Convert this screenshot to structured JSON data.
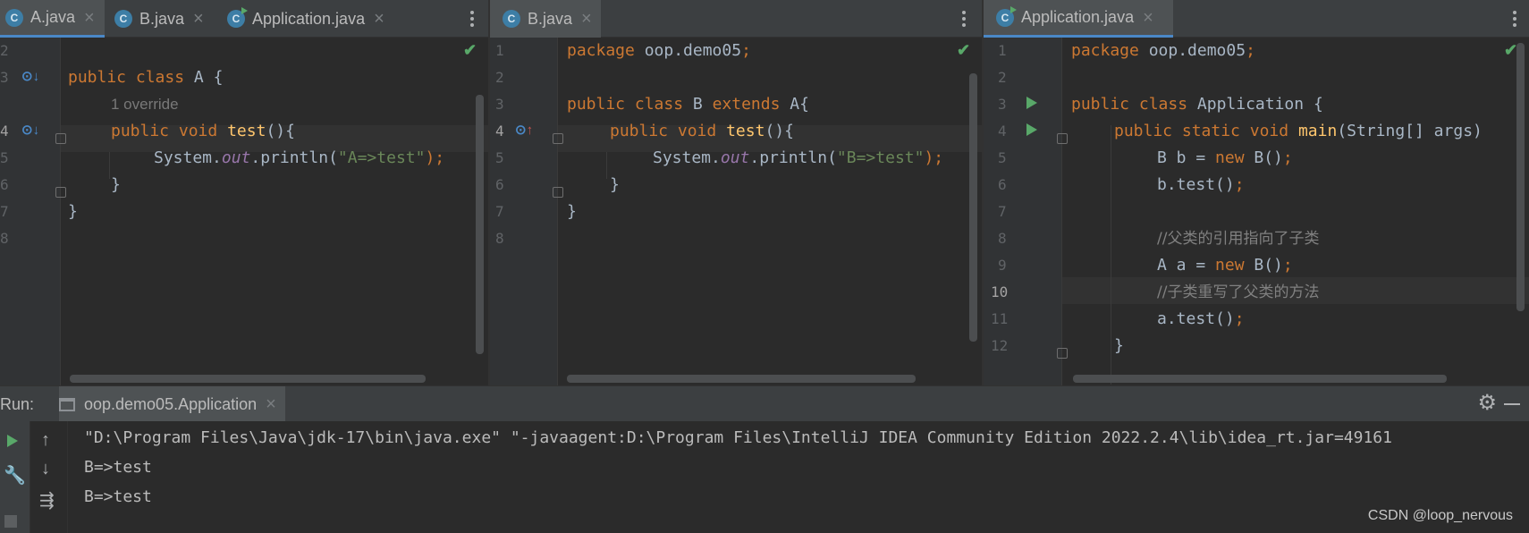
{
  "panes": [
    {
      "tabs": [
        {
          "label": "A.java",
          "icon": "class-icon",
          "active": true
        },
        {
          "label": "B.java",
          "icon": "class-icon"
        },
        {
          "label": "Application.java",
          "icon": "runnable-class-icon"
        }
      ],
      "line_numbers": [
        "2",
        "3",
        "4",
        "5",
        "6",
        "7",
        "8"
      ],
      "hint": "1 override",
      "code": {
        "l3": {
          "kw1": "public",
          "kw2": "class",
          "rest": " A {"
        },
        "l4": {
          "kw1": "public",
          "kw2": "void",
          "fn": "test",
          "rest": "(){"
        },
        "l5": {
          "a": "System.",
          "st": "out",
          "b": ".println(",
          "s": "\"A=>test\"",
          "c": ");"
        },
        "l6": "}",
        "l7": "}"
      }
    },
    {
      "tabs": [
        {
          "label": "B.java",
          "icon": "class-icon",
          "active": true
        }
      ],
      "line_numbers": [
        "1",
        "2",
        "3",
        "4",
        "5",
        "6",
        "7",
        "8"
      ],
      "code": {
        "l1": {
          "kw": "package",
          "rest": " oop.demo05",
          "semi": ";"
        },
        "l3": {
          "kw1": "public",
          "kw2": "class",
          "mid": " B ",
          "kw3": "extends",
          "rest": " A{"
        },
        "l4": {
          "kw1": "public",
          "kw2": "void",
          "fn": "test",
          "rest": "(){"
        },
        "l5": {
          "a": "System.",
          "st": "out",
          "b": ".println(",
          "s": "\"B=>test\"",
          "c": ");"
        },
        "l6": "}",
        "l7": "}"
      }
    },
    {
      "tabs": [
        {
          "label": "Application.java",
          "icon": "runnable-class-icon",
          "active": true
        }
      ],
      "line_numbers": [
        "1",
        "2",
        "3",
        "4",
        "5",
        "6",
        "7",
        "8",
        "9",
        "10",
        "11",
        "12"
      ],
      "code": {
        "l1": {
          "kw": "package",
          "rest": " oop.demo05",
          "semi": ";"
        },
        "l3": {
          "kw1": "public",
          "kw2": "class",
          "rest": " Application {"
        },
        "l4": {
          "kw1": "public",
          "kw2": "static",
          "kw3": "void",
          "fn": "main",
          "rest": "(String[] args)"
        },
        "l5": {
          "a": "B b = ",
          "kw": "new",
          "b": " B()",
          "semi": ";"
        },
        "l6": {
          "a": "b.test()",
          "semi": ";"
        },
        "l8": "//父类的引用指向了子类",
        "l9": {
          "a": "A a = ",
          "kw": "new",
          "b": " B()",
          "semi": ";"
        },
        "l10": "//子类重写了父类的方法",
        "l11": {
          "a": "a.test()",
          "semi": ";"
        },
        "l12": "}"
      }
    }
  ],
  "run": {
    "label": "Run:",
    "tab": "oop.demo05.Application",
    "output": [
      "\"D:\\Program Files\\Java\\jdk-17\\bin\\java.exe\" \"-javaagent:D:\\Program Files\\IntelliJ IDEA Community Edition 2022.2.4\\lib\\idea_rt.jar=49161",
      "B=>test",
      "B=>test"
    ]
  },
  "watermark": "CSDN @loop_nervous",
  "colors": {
    "keyword": "#cc7832",
    "function": "#ffc66d",
    "string": "#6a8759",
    "static_field": "#9876aa",
    "comment": "#808080",
    "run_green": "#59a869"
  }
}
